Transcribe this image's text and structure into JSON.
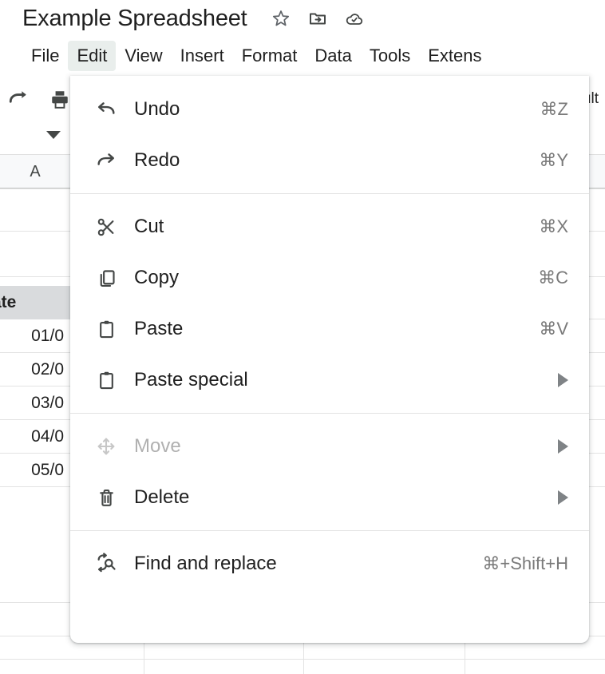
{
  "titlebar": {
    "document_title": "Example Spreadsheet",
    "icons": [
      {
        "name": "star-icon",
        "label": "Star"
      },
      {
        "name": "move-to-folder-icon",
        "label": "Move"
      },
      {
        "name": "cloud-saved-icon",
        "label": "Saved to Drive"
      }
    ]
  },
  "menubar": {
    "items": [
      {
        "label": "File",
        "active": false
      },
      {
        "label": "Edit",
        "active": true
      },
      {
        "label": "View",
        "active": false
      },
      {
        "label": "Insert",
        "active": false
      },
      {
        "label": "Format",
        "active": false
      },
      {
        "label": "Data",
        "active": false
      },
      {
        "label": "Tools",
        "active": false
      },
      {
        "label": "Extens",
        "active": false
      }
    ]
  },
  "toolbar": {
    "redo_icon": "redo-icon",
    "print_icon": "print-icon",
    "font_value": "ult"
  },
  "grid": {
    "column_headers": [
      "A"
    ],
    "header_cell": "ate",
    "cells": [
      "01/0",
      "02/0",
      "03/0",
      "04/0",
      "05/0"
    ]
  },
  "edit_menu": {
    "name": "edit-menu",
    "groups": [
      {
        "items": [
          {
            "name": "undo",
            "label": "Undo",
            "accel": "⌘Z",
            "icon": "undo-icon",
            "disabled": false,
            "submenu": false
          },
          {
            "name": "redo",
            "label": "Redo",
            "accel": "⌘Y",
            "icon": "redo-icon",
            "disabled": false,
            "submenu": false
          }
        ]
      },
      {
        "items": [
          {
            "name": "cut",
            "label": "Cut",
            "accel": "⌘X",
            "icon": "scissors-icon",
            "disabled": false,
            "submenu": false
          },
          {
            "name": "copy",
            "label": "Copy",
            "accel": "⌘C",
            "icon": "copy-icon",
            "disabled": false,
            "submenu": false
          },
          {
            "name": "paste",
            "label": "Paste",
            "accel": "⌘V",
            "icon": "clipboard-icon",
            "disabled": false,
            "submenu": false
          },
          {
            "name": "paste-special",
            "label": "Paste special",
            "accel": "",
            "icon": "clipboard-icon",
            "disabled": false,
            "submenu": true
          }
        ]
      },
      {
        "items": [
          {
            "name": "move",
            "label": "Move",
            "accel": "",
            "icon": "move-arrows-icon",
            "disabled": true,
            "submenu": true
          },
          {
            "name": "delete",
            "label": "Delete",
            "accel": "",
            "icon": "trash-icon",
            "disabled": false,
            "submenu": true
          }
        ]
      },
      {
        "items": [
          {
            "name": "find-and-replace",
            "label": "Find and replace",
            "accel": "⌘+Shift+H",
            "icon": "find-replace-icon",
            "disabled": false,
            "submenu": false
          }
        ]
      }
    ]
  },
  "colors": {
    "menu_active_bg": "#e9eeec",
    "text_primary": "#1f1f1f",
    "text_secondary": "#444746",
    "accel_text": "#7a7a7a",
    "disabled_text": "#b0b0b0",
    "gridline": "#e3e3e3",
    "header_cell_bg": "#d9dbdd"
  }
}
